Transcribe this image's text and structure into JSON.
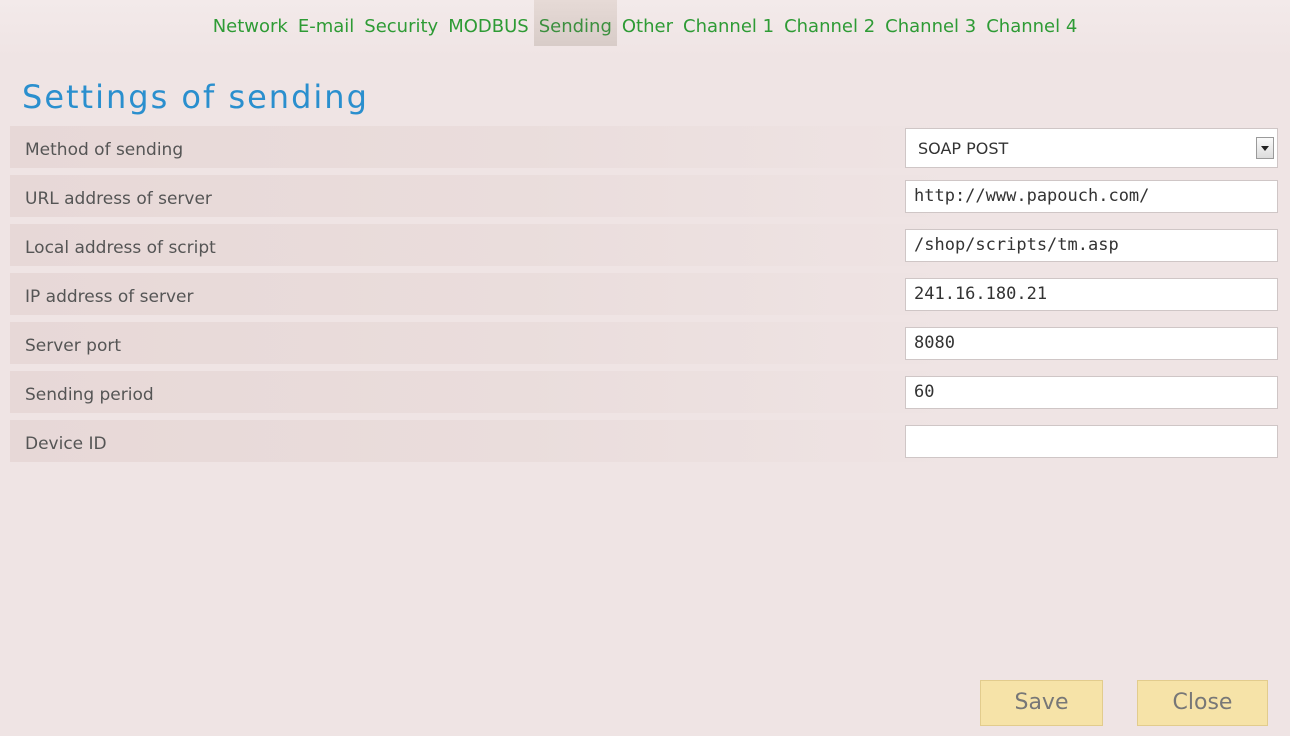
{
  "tabs": [
    {
      "label": "Network"
    },
    {
      "label": "E-mail"
    },
    {
      "label": "Security"
    },
    {
      "label": "MODBUS"
    },
    {
      "label": "Sending",
      "active": true
    },
    {
      "label": "Other"
    },
    {
      "label": "Channel 1"
    },
    {
      "label": "Channel 2"
    },
    {
      "label": "Channel 3"
    },
    {
      "label": "Channel 4"
    }
  ],
  "page": {
    "title": "Settings of sending"
  },
  "form": {
    "method": {
      "label": "Method of sending",
      "value": "SOAP POST"
    },
    "url": {
      "label": "URL address of server",
      "value": "http://www.papouch.com/"
    },
    "script": {
      "label": "Local address of script",
      "value": "/shop/scripts/tm.asp"
    },
    "ip": {
      "label": "IP address of server",
      "value": "241.16.180.21"
    },
    "port": {
      "label": "Server port",
      "value": "8080"
    },
    "period": {
      "label": "Sending period",
      "value": "60"
    },
    "device_id": {
      "label": "Device ID",
      "value": ""
    }
  },
  "buttons": {
    "save": "Save",
    "close": "Close"
  },
  "colors": {
    "accent": "#2a8fce",
    "tab_text": "#2e9b35",
    "button_bg": "#f6e3a8",
    "background": "#efe4e4"
  }
}
